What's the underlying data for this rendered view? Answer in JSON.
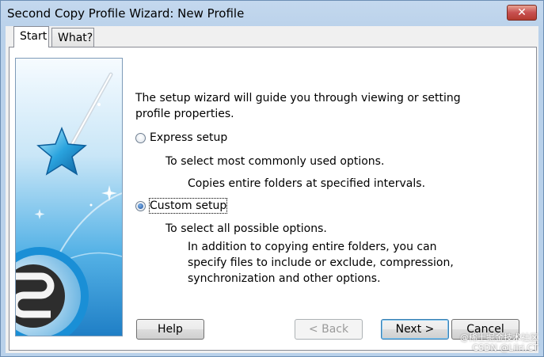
{
  "window": {
    "title": "Second Copy Profile Wizard: New Profile",
    "close_label": "✕"
  },
  "tabs": [
    {
      "label": "Start",
      "active": true
    },
    {
      "label": "What?",
      "active": false
    }
  ],
  "intro": {
    "line1": "The setup wizard will guide you through viewing or setting",
    "line2": "profile properties."
  },
  "options": {
    "express": {
      "label": "Express setup",
      "checked": false,
      "desc": "To select most commonly used options.",
      "detail": "Copies entire folders at specified intervals."
    },
    "custom": {
      "label": "Custom setup",
      "checked": true,
      "desc": "To select all possible options.",
      "detail_lines": [
        "In addition to copying entire folders, you can",
        "specify files to include or exclude, compression,",
        "synchronization and other options."
      ]
    }
  },
  "buttons": {
    "help": "Help",
    "back": "< Back",
    "next": "Next >",
    "cancel": "Cancel"
  },
  "watermark": {
    "line1": "@稀土掘金技术社区",
    "line2": "CSDN @Lilri.CT"
  },
  "icons": {
    "banner": "magic-wand-logo-illustration"
  }
}
